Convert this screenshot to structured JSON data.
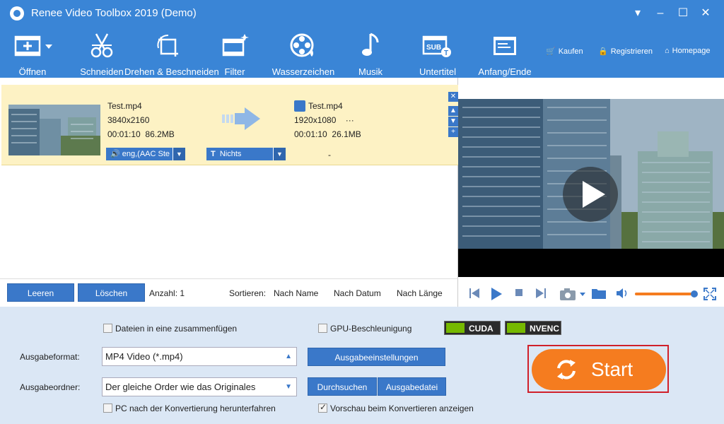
{
  "window": {
    "title": "Renee Video Toolbox 2019 (Demo)",
    "controls": {
      "menu": "▾",
      "minimize": "–",
      "maximize": "☐",
      "close": "✕"
    }
  },
  "toolbar": {
    "items": [
      {
        "label": "Öffnen",
        "icon": "add-video-icon"
      },
      {
        "label": "Schneiden",
        "icon": "scissors-icon"
      },
      {
        "label": "Drehen & Beschneiden",
        "icon": "crop-rotate-icon"
      },
      {
        "label": "Filter",
        "icon": "filter-icon"
      },
      {
        "label": "Wasserzeichen",
        "icon": "watermark-icon"
      },
      {
        "label": "Musik",
        "icon": "music-icon"
      },
      {
        "label": "Untertitel",
        "icon": "subtitle-icon"
      },
      {
        "label": "Anfang/Ende",
        "icon": "intro-outro-icon"
      }
    ],
    "right_links": {
      "buy": "Kaufen",
      "register": "Registrieren",
      "homepage": "Homepage"
    }
  },
  "file": {
    "source": {
      "name": "Test.mp4",
      "resolution": "3840x2160",
      "duration": "00:01:10",
      "size": "86.2MB"
    },
    "output": {
      "name": "Test.mp4",
      "resolution": "1920x1080",
      "more": "···",
      "duration": "00:01:10",
      "size": "26.1MB"
    },
    "audio_track": "eng,(AAC Ste",
    "subtitle": "Nichts",
    "dash": "-"
  },
  "list_footer": {
    "clear_label": "Leeren",
    "delete_label": "Löschen",
    "count_label": "Anzahl: 1",
    "sort_label": "Sortieren:",
    "sort_name": "Nach Name",
    "sort_date": "Nach Datum",
    "sort_length": "Nach Länge"
  },
  "player": {
    "volume_percent": 100
  },
  "settings": {
    "merge_label": "Dateien in eine zusammenfügen",
    "merge_checked": false,
    "gpu_label": "GPU-Beschleunigung",
    "gpu_checked": false,
    "cuda": "CUDA",
    "nvenc": "NVENC",
    "format_label": "Ausgabeformat:",
    "format_value": "MP4 Video (*.mp4)",
    "output_settings_label": "Ausgabeeinstellungen",
    "folder_label": "Ausgabeordner:",
    "folder_value": "Der gleiche Order wie das Originales",
    "browse_label": "Durchsuchen",
    "output_file_label": "Ausgabedatei",
    "shutdown_label": "PC nach der Konvertierung herunterfahren",
    "shutdown_checked": false,
    "preview_label": "Vorschau beim Konvertieren anzeigen",
    "preview_checked": true,
    "start_label": "Start"
  },
  "colors": {
    "accent": "#3a85d6",
    "button": "#3a78c9",
    "selected_row": "#fdf2c4",
    "start": "#f57c1f",
    "highlight_border": "#d0202a"
  }
}
